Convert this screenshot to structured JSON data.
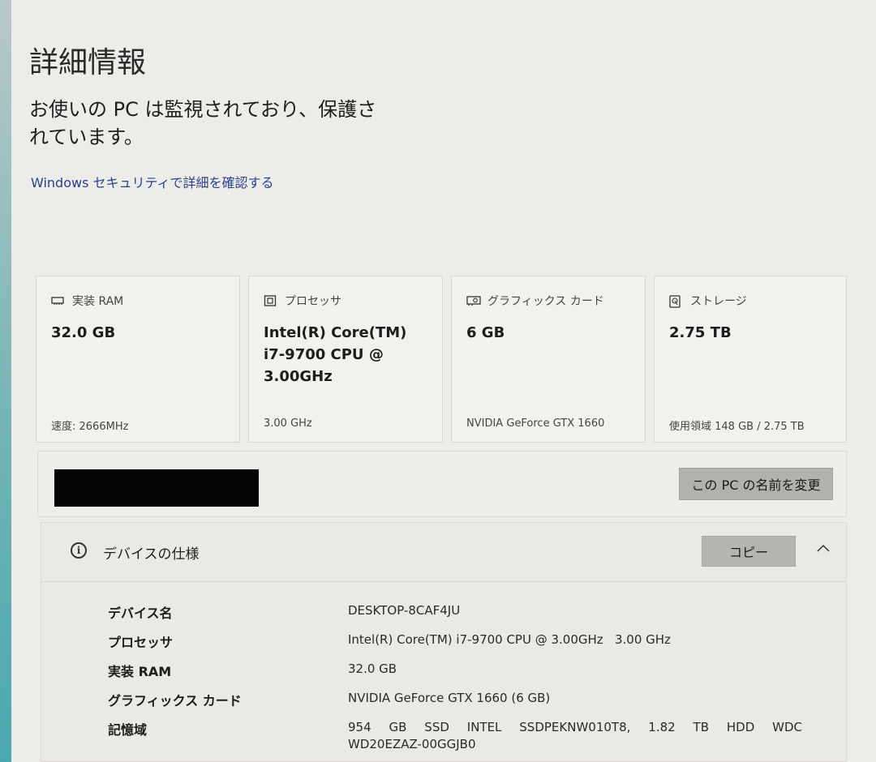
{
  "page": {
    "title": "詳細情報",
    "status": "お使いの PC は監視されており、保護されています。",
    "security_link": "Windows セキュリティで詳細を確認する"
  },
  "cards": [
    {
      "icon": "memory-icon",
      "label": "実装 RAM",
      "value": "32.0 GB",
      "sub": "速度: 2666MHz"
    },
    {
      "icon": "processor-icon",
      "label": "プロセッサ",
      "value": "Intel(R) Core(TM) i7-9700 CPU @ 3.00GHz",
      "sub": "3.00 GHz"
    },
    {
      "icon": "graphics-card-icon",
      "label": "グラフィックス カード",
      "value": "6 GB",
      "sub": "NVIDIA GeForce GTX 1660"
    },
    {
      "icon": "storage-icon",
      "label": "ストレージ",
      "value": "2.75 TB",
      "sub": "使用領域 148 GB / 2.75 TB"
    }
  ],
  "rename": {
    "button_label": "この PC の名前を変更"
  },
  "device_spec": {
    "title": "デバイスの仕様",
    "copy_label": "コピー",
    "rows": [
      {
        "label": "デバイス名",
        "value": "DESKTOP-8CAF4JU"
      },
      {
        "label": "プロセッサ",
        "value": "Intel(R) Core(TM) i7-9700 CPU @ 3.00GHz   3.00 GHz"
      },
      {
        "label": "実装 RAM",
        "value": "32.0 GB"
      },
      {
        "label": "グラフィックス カード",
        "value": "NVIDIA GeForce GTX 1660 (6 GB)"
      },
      {
        "label": "記憶域",
        "value": "954 GB SSD INTEL SSDPEKNW010T8, 1.82 TB HDD WDC WD20EZAZ-00GGJB0"
      }
    ]
  }
}
